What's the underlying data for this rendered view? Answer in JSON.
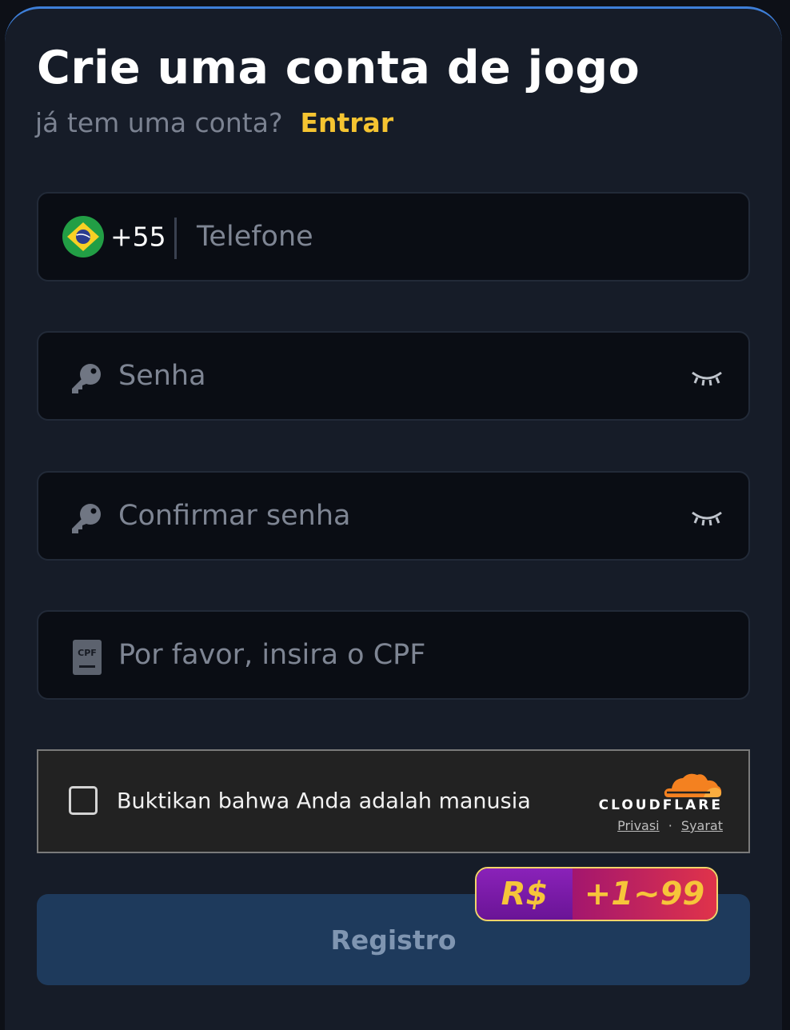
{
  "header": {
    "title": "Crie uma conta de jogo",
    "subtitle": "já tem uma conta?",
    "login_link": "Entrar"
  },
  "phone": {
    "country_code": "+55",
    "placeholder": "Telefone",
    "flag_icon": "brazil-flag-icon"
  },
  "password": {
    "placeholder": "Senha",
    "icon": "key-icon",
    "toggle_icon": "eye-closed-icon"
  },
  "confirm_password": {
    "placeholder": "Confirmar senha",
    "icon": "key-icon",
    "toggle_icon": "eye-closed-icon"
  },
  "cpf": {
    "placeholder": "Por favor, insira o CPF",
    "icon": "cpf-card-icon",
    "icon_text": "CPF"
  },
  "captcha": {
    "label": "Buktikan bahwa Anda adalah manusia",
    "brand": "CLOUDFLARE",
    "privacy": "Privasi",
    "dot": "·",
    "terms": "Syarat"
  },
  "register": {
    "label": "Registro"
  },
  "bonus_badge": {
    "currency": "R$",
    "range": "+1~99"
  },
  "colors": {
    "accent_link": "#f5c431",
    "panel_border": "#3e7fd8",
    "button_bg": "#1e3a5c",
    "cloudflare_orange": "#f48120"
  }
}
